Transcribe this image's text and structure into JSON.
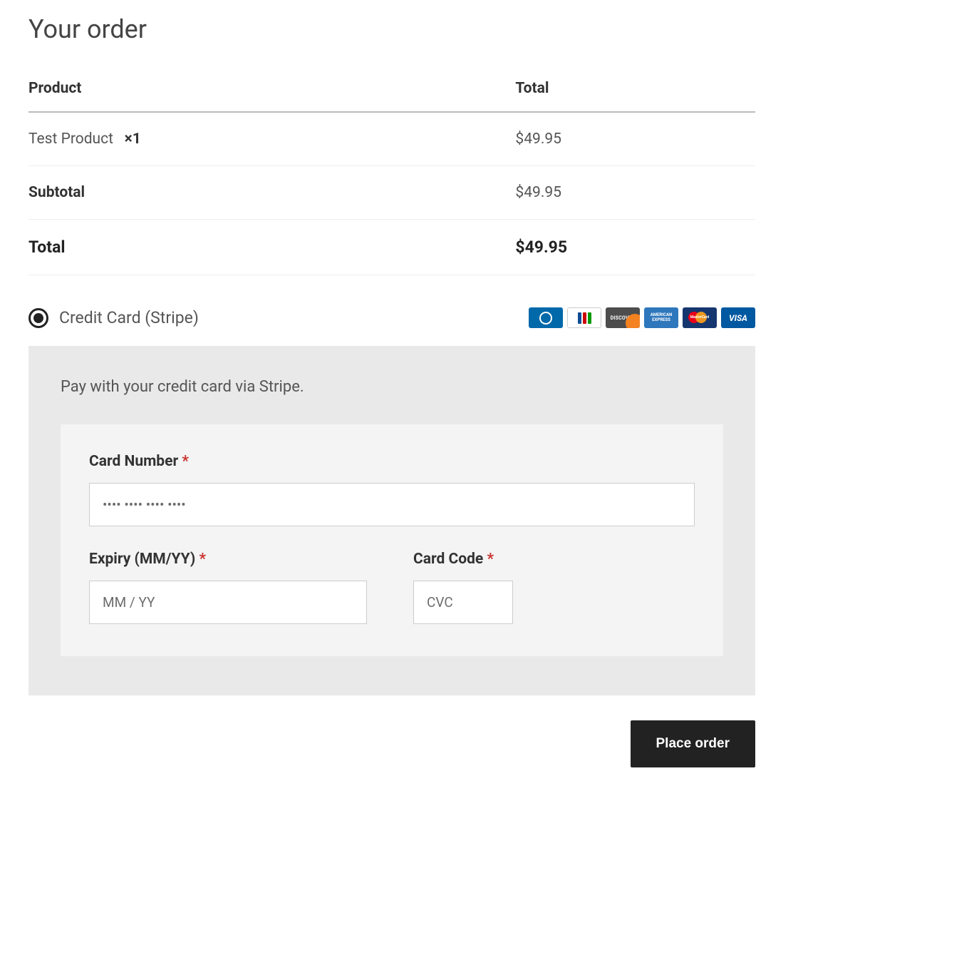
{
  "title": "Your order",
  "table": {
    "headers": {
      "product": "Product",
      "total": "Total"
    },
    "items": [
      {
        "name": "Test Product",
        "qty_prefix": "×",
        "qty": "1",
        "total": "$49.95"
      }
    ],
    "subtotal": {
      "label": "Subtotal",
      "value": "$49.95"
    },
    "total": {
      "label": "Total",
      "value": "$49.95"
    }
  },
  "payment": {
    "method_label": "Credit Card (Stripe)",
    "card_brands": [
      "diners",
      "jcb",
      "discover",
      "amex",
      "mastercard",
      "visa"
    ],
    "description": "Pay with your credit card via Stripe.",
    "card_number": {
      "label": "Card Number",
      "required": "*",
      "placeholder": "•••• •••• •••• ••••",
      "value": ""
    },
    "expiry": {
      "label": "Expiry (MM/YY)",
      "required": "*",
      "placeholder": "MM / YY",
      "value": ""
    },
    "cvc": {
      "label": "Card Code",
      "required": "*",
      "placeholder": "CVC",
      "value": ""
    }
  },
  "actions": {
    "place_order": "Place order"
  }
}
